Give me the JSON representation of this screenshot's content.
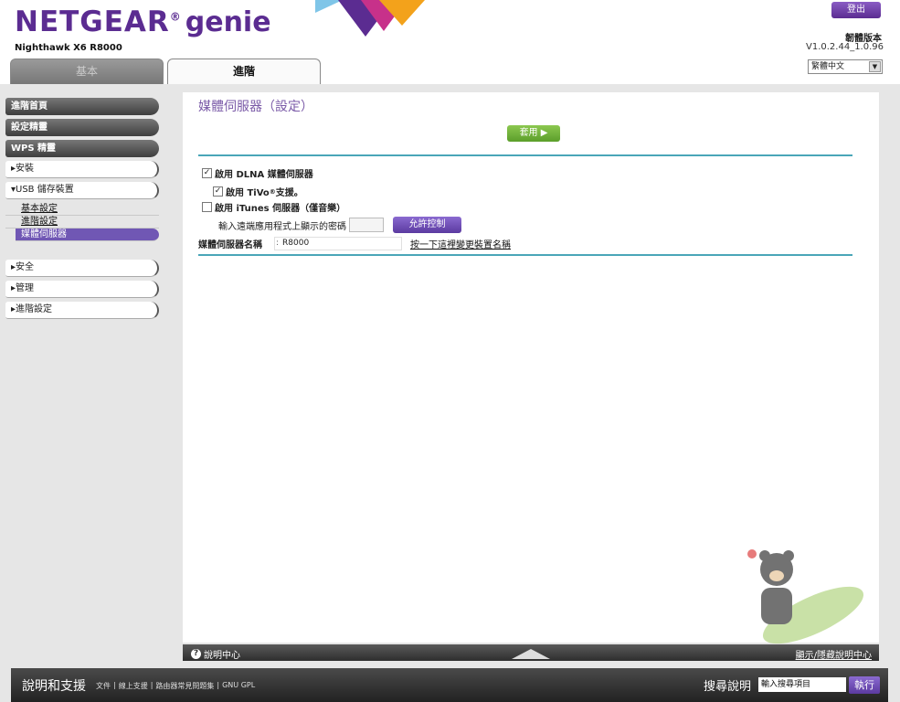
{
  "header": {
    "logo_brand": "NETGEAR",
    "logo_genie": "genie",
    "model": "Nighthawk X6 R8000",
    "logout_label": "登出",
    "firmware_label": "韌體版本",
    "firmware_version": "V1.0.2.44_1.0.96",
    "language": "繁體中文"
  },
  "tabs": {
    "basic": "基本",
    "advanced": "進階"
  },
  "sidebar": {
    "advanced_home": "進階首頁",
    "setup_wizard": "設定精靈",
    "wps_wizard": "WPS 精靈",
    "setup": "▸安裝",
    "usb_storage": "▾USB 儲存裝置",
    "usb_basic": "基本設定",
    "usb_advanced": "進階設定",
    "usb_media_server": "媒體伺服器",
    "security": "▸安全",
    "administration": "▸管理",
    "advanced_setup": "▸進階設定"
  },
  "main": {
    "title": "媒體伺服器（設定）",
    "apply_label": "套用 ▶",
    "dlna_label": "啟用 DLNA 媒體伺服器",
    "tivo_label_pre": "啟用 TiVo",
    "tivo_sup": "®",
    "tivo_label_post": " 支援。",
    "itunes_label": "啟用 iTunes 伺服器（僅音樂）",
    "password_label": "輸入遠端應用程式上顯示的密碼",
    "allow_control_label": "允許控制",
    "server_name_label": "媒體伺服器名稱",
    "server_name_value": "R8000",
    "change_name_link": "按一下這裡變更裝置名稱"
  },
  "help_bar": {
    "help_center": "說明中心",
    "show_hide": "顯示/隱藏說明中心"
  },
  "footer": {
    "title": "說明和支援",
    "links": [
      "文件",
      "線上支援",
      "路由器常見問題集",
      "GNU GPL"
    ],
    "search_label": "搜尋說明",
    "search_value": "輸入搜尋項目",
    "search_button": "執行"
  }
}
